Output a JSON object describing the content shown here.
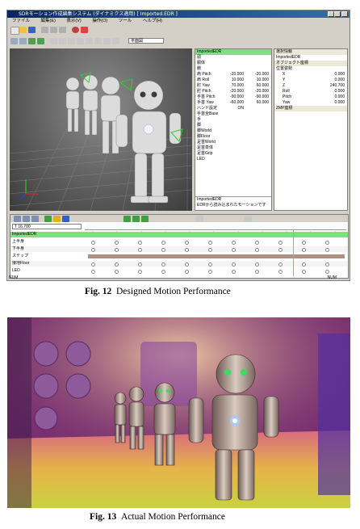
{
  "figure12": {
    "app_title": "SDRモーション作成編集システム (ダイナミクス適用) [ Imported.EDR ]",
    "menu": [
      "ファイル",
      "編集(E)",
      "表示(V)",
      "操作(O)",
      "ツール",
      "ヘルプ(H)"
    ],
    "toolbar_combo": "平面図",
    "props_panel": {
      "title": "ImportedEDR",
      "rows": [
        {
          "label": "頭",
          "v1": "",
          "v2": ""
        },
        {
          "label": "胴体",
          "v1": "",
          "v2": ""
        },
        {
          "label": "腕",
          "v1": "",
          "v2": ""
        },
        {
          "label": "肩 Pitch",
          "v1": "-20.000",
          "v2": "-20.000"
        },
        {
          "label": "肩 Roll",
          "v1": "10.000",
          "v2": "10.000"
        },
        {
          "label": "肘 Yaw",
          "v1": "70.000",
          "v2": "60.000"
        },
        {
          "label": "肘 Pitch",
          "v1": "-20.000",
          "v2": "-20.000"
        },
        {
          "label": "手首 Pitch",
          "v1": "-90.000",
          "v2": "-90.000"
        },
        {
          "label": "手首 Yaw",
          "v1": "-60.000",
          "v2": "60.000"
        },
        {
          "label": "ハンド設定",
          "v1": "ON",
          "v2": ""
        },
        {
          "label": "手首全Base",
          "v1": "",
          "v2": ""
        },
        {
          "label": "手",
          "v1": "",
          "v2": ""
        },
        {
          "label": "脚",
          "v1": "",
          "v2": ""
        },
        {
          "label": "脚World",
          "v1": "",
          "v2": ""
        },
        {
          "label": "脚Floor",
          "v1": "",
          "v2": ""
        },
        {
          "label": "足首World",
          "v1": "",
          "v2": ""
        },
        {
          "label": "足首単体",
          "v1": "",
          "v2": ""
        },
        {
          "label": "足首Grip",
          "v1": "",
          "v2": ""
        },
        {
          "label": "LED",
          "v1": "",
          "v2": ""
        }
      ],
      "footer_title": "ImportedEDR",
      "footer_text": "EDRから読み込まれたモーションです"
    },
    "coord_panel": {
      "sections": [
        "選択情報",
        "ImportedEDR",
        "オブジェクト座標",
        "位置姿勢"
      ],
      "rows": [
        {
          "label": "X",
          "value": "0.000"
        },
        {
          "label": "Y",
          "value": "0.000"
        },
        {
          "label": "Z",
          "value": "240.700"
        },
        {
          "label": "Roll",
          "value": "0.000"
        },
        {
          "label": "Pitch",
          "value": "0.000"
        },
        {
          "label": "Yaw",
          "value": "0.000"
        }
      ],
      "last_section": "ZMP座標"
    },
    "timeline": {
      "time_field": "T 16.700",
      "tracks": [
        "ImportedEDR",
        "上半身",
        "下半身",
        "ステップ",
        "接地Floor",
        "LED"
      ]
    },
    "status_left": "NUM",
    "status_right": "NUM"
  },
  "caption12": {
    "label": "Fig. 12",
    "text": "Designed Motion Performance"
  },
  "caption13": {
    "label": "Fig. 13",
    "text": "Actual Motion Performance"
  }
}
